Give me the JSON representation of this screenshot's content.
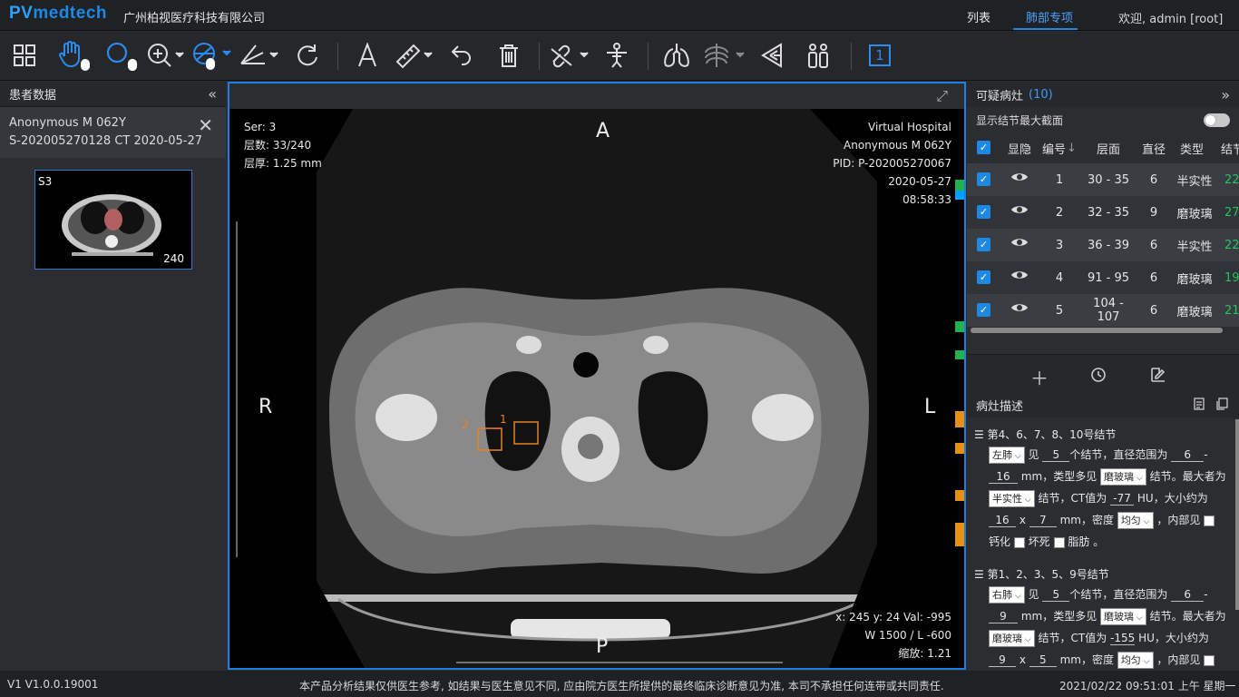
{
  "header": {
    "logo_pv": "PV",
    "logo_rest": "medtech",
    "company": "广州柏视医疗科技有限公司",
    "nav": [
      "列表",
      "肺部专项"
    ],
    "active_nav": 1,
    "user": "欢迎, admin [root]"
  },
  "toolbar": {
    "tools": [
      "grid-layout",
      "hand-pan",
      "window-level",
      "zoom",
      "crosshair",
      "measure-angle",
      "rotate",
      "text-annotation",
      "ruler",
      "undo",
      "delete",
      "link",
      "body-position",
      "lung",
      "rib",
      "volume-render",
      "compare",
      "slice-number"
    ],
    "slice_number_label": "1"
  },
  "left_panel": {
    "title": "患者数据",
    "patient_line1": "Anonymous   M   062Y",
    "patient_line2": "S-202005270128 CT 2020-05-27",
    "thumbnail_series": "S3",
    "thumbnail_count": "240"
  },
  "viewer": {
    "series": "Ser: 3",
    "slice": "层数: 33/240",
    "thickness": "层厚: 1.25 mm",
    "hospital": "Virtual Hospital",
    "patient": "Anonymous M 062Y",
    "pid": "PID: P-202005270067",
    "date": "2020-05-27",
    "time": "08:58:33",
    "orient_top": "A",
    "orient_bottom": "P",
    "orient_left": "R",
    "orient_right": "L",
    "cursor": "x: 245 y: 24 Val: -995",
    "window": "W 1500 / L -600",
    "zoom": "缩放: 1.21",
    "nodule_labels": [
      "1",
      "2"
    ]
  },
  "right_panel": {
    "title": "可疑病灶",
    "count": "(10)",
    "toggle_label": "显示结节最大截面",
    "columns": [
      "显隐",
      "编号",
      "层面",
      "直径",
      "类型",
      "结节"
    ],
    "rows": [
      {
        "no": "1",
        "slice": "30 - 35",
        "diam": "6",
        "type": "半实性",
        "extra": "22"
      },
      {
        "no": "2",
        "slice": "32 - 35",
        "diam": "9",
        "type": "磨玻璃",
        "extra": "27"
      },
      {
        "no": "3",
        "slice": "36 - 39",
        "diam": "6",
        "type": "半实性",
        "extra": "22"
      },
      {
        "no": "4",
        "slice": "91 - 95",
        "diam": "6",
        "type": "磨玻璃",
        "extra": "19"
      },
      {
        "no": "5",
        "slice": "104 - 107",
        "diam": "6",
        "type": "磨玻璃",
        "extra": "21"
      }
    ],
    "desc_title": "病灶描述",
    "desc_groups": [
      {
        "title": "第4、6、7、8、10号结节",
        "side": "左肺",
        "count": "5",
        "dmin": "6",
        "dmax": "16",
        "common_type": "磨玻璃",
        "max_type": "半实性",
        "ct": "-77",
        "w": "16",
        "h": "7",
        "density": "均匀"
      },
      {
        "title": "第1、2、3、5、9号结节",
        "side": "右肺",
        "count": "5",
        "dmin": "6",
        "dmax": "9",
        "common_type": "磨玻璃",
        "max_type": "磨玻璃",
        "ct": "-155",
        "w": "9",
        "h": "5",
        "density": "均匀"
      }
    ],
    "text": {
      "see": "见",
      "nodules_range": "个结节，直径范围为",
      "dash": "-",
      "mm_common": "mm，类型多见",
      "nodule_max": "结节。最大者为",
      "ct_value": "结节，CT值为",
      "hu_size": "HU，大小约为",
      "x": "x",
      "mm_density": "mm，密度",
      "inside": "，内部见",
      "calc": "钙化",
      "necrosis": "坏死",
      "fat": "脂肪",
      "period": "。"
    }
  },
  "status": {
    "version": "V1 V1.0.0.19001",
    "disclaimer": "本产品分析结果仅供医生参考, 如结果与医生意见不同, 应由院方医生所提供的最终临床诊断意见为准, 本司不承担任何连带或共同责任.",
    "datetime": "2021/02/22 09:51:01 上午 星期一"
  },
  "colors": {
    "accent": "#1e88e5",
    "nodule_box": "#e8821e",
    "green": "#22c55e"
  }
}
